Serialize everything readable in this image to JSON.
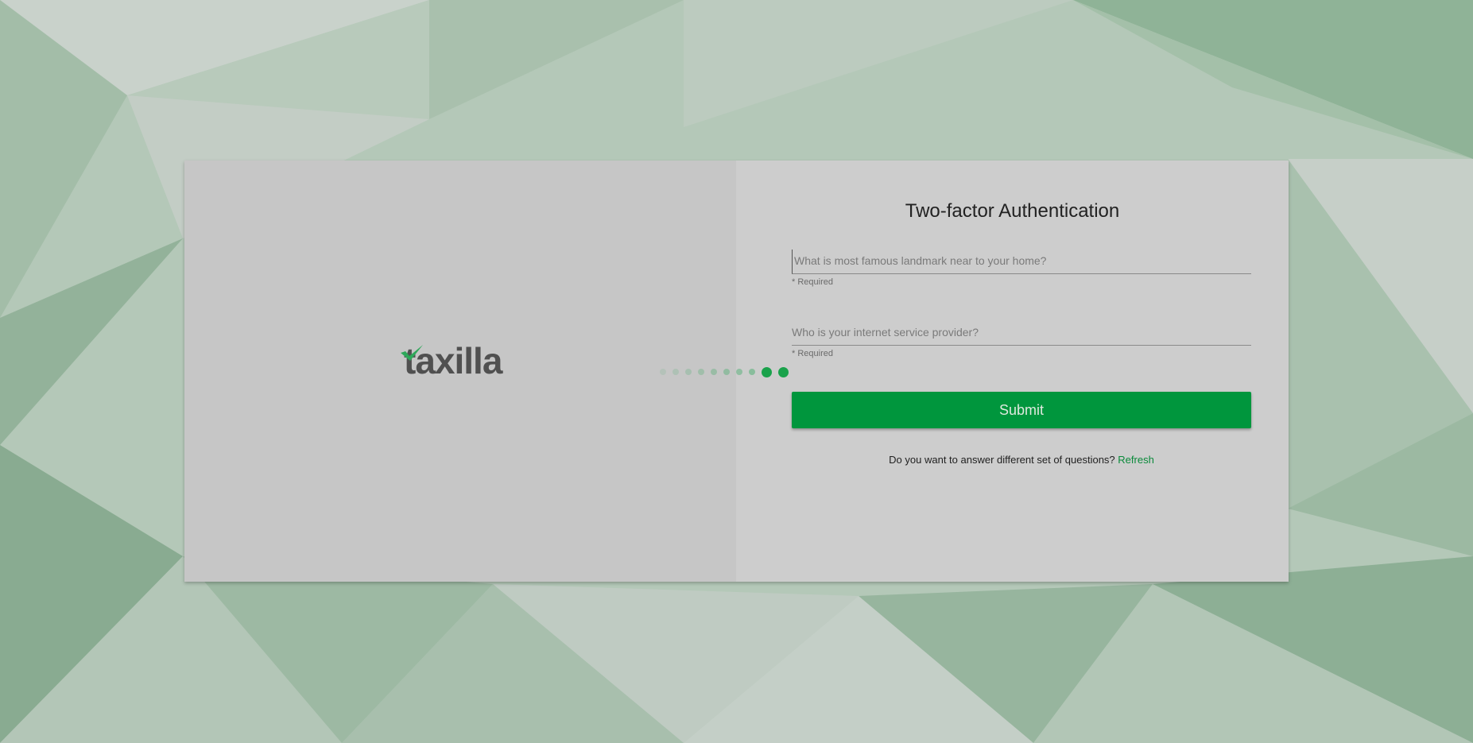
{
  "logo": {
    "text": "taxilla",
    "icon": "checkmark-icon"
  },
  "form": {
    "title": "Two-factor Authentication",
    "questions": [
      {
        "placeholder": "What is most famous landmark near to your home?",
        "value": "",
        "hint": "* Required"
      },
      {
        "placeholder": "Who is your internet service provider?",
        "value": "",
        "hint": "* Required"
      }
    ],
    "submit_label": "Submit",
    "refresh_prompt": "Do you want to answer different set of questions?",
    "refresh_link": "Refresh"
  },
  "loader": {
    "dot_count": 10
  },
  "colors": {
    "accent": "#00963d",
    "link": "#0a8a3a",
    "loader": "#1aa24b",
    "left_panel": "#c6c6c6",
    "right_panel": "#cdcdcd"
  }
}
